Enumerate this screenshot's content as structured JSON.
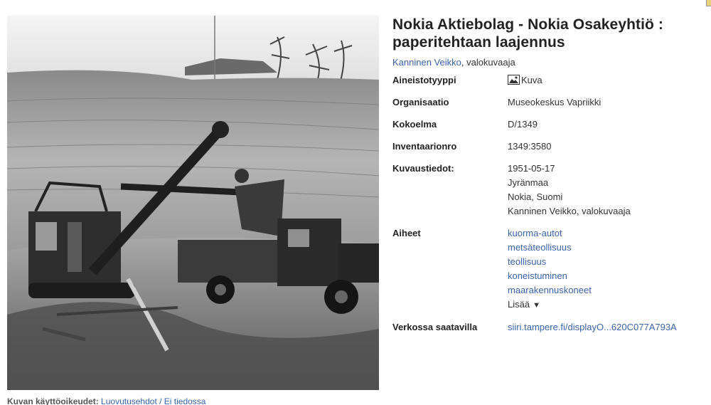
{
  "record": {
    "title": "Nokia Aktiebolag - Nokia Osakeyhtiö : paperitehtaan laajennus",
    "author_link": "Kanninen Veikko",
    "author_role": ", valokuvaaja"
  },
  "photo": {
    "icon": "photograph"
  },
  "fields": {
    "type_label": "Aineistotyyppi",
    "type_value": "Kuva",
    "type_icon": "image-icon",
    "org_label": "Organisaatio",
    "org_value": "Museokeskus Vapriikki",
    "collection_label": "Kokoelma",
    "collection_value": "D/1349",
    "inventory_label": "Inventaarionro",
    "inventory_value": "1349:3580",
    "photo_info_label": "Kuvaustiedot:",
    "photo_info": [
      "1951-05-17",
      "Jyränmaa",
      "Nokia, Suomi",
      "Kanninen Veikko, valokuvaaja"
    ],
    "subjects_label": "Aiheet",
    "subjects": [
      "kuorma-autot",
      "metsäteollisuus",
      "teollisuus",
      "koneistuminen",
      "maarakennuskoneet"
    ],
    "more_label": "Lisää",
    "online_label": "Verkossa saatavilla",
    "online_link": "siiri.tampere.fi/displayO...620C077A793A"
  },
  "footer": {
    "rights_label": "Kuvan käyttöoikeudet:",
    "rights_value": "Luovutusehdot / Ei tiedossa"
  },
  "colors": {
    "link": "#3a62a8",
    "text": "#222222"
  }
}
